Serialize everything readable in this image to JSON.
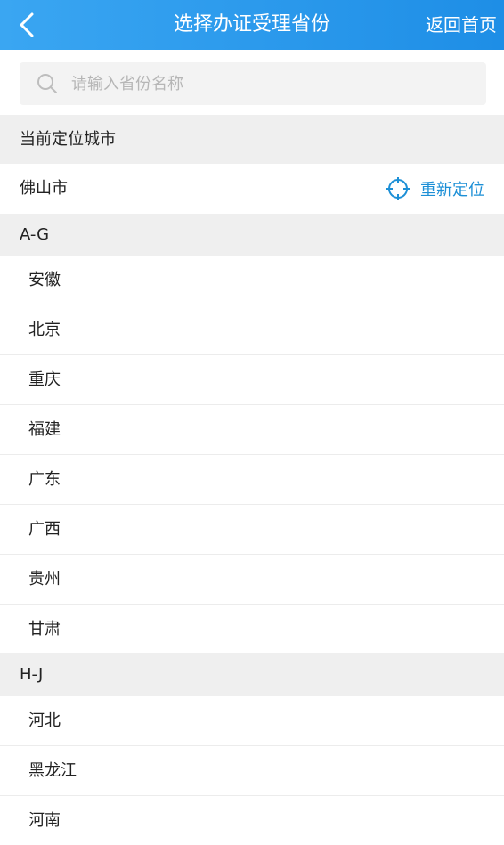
{
  "header": {
    "title": "选择办证受理省份",
    "home_label": "返回首页"
  },
  "search": {
    "value": "",
    "placeholder": "请输入省份名称"
  },
  "current_location": {
    "section_label": "当前定位城市",
    "city": "佛山市",
    "relocate_label": "重新定位"
  },
  "groups": [
    {
      "label": "A-G",
      "items": [
        "安徽",
        "北京",
        "重庆",
        "福建",
        "广东",
        "广西",
        "贵州",
        "甘肃"
      ]
    },
    {
      "label": "H-J",
      "items": [
        "河北",
        "黑龙江",
        "河南"
      ]
    }
  ],
  "colors": {
    "header_bg": "#2196ee",
    "accent": "#1c8fd6",
    "section_bg": "#efefef"
  },
  "icons": [
    "chevron-left-icon",
    "search-icon",
    "crosshair-icon"
  ]
}
